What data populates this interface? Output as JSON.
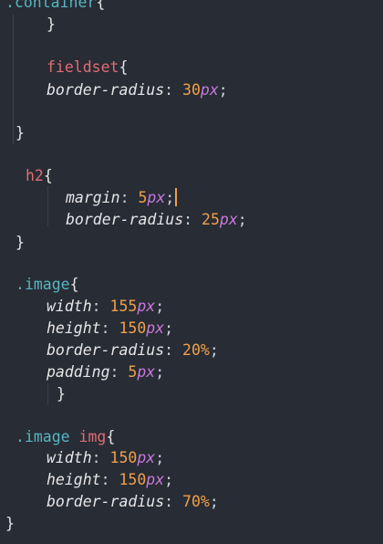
{
  "theme": {
    "background": "#282c34",
    "selector": "#e06c75",
    "class_dot": "#56b6c2",
    "number": "#f0a04b",
    "unit": "#c678dd",
    "cursor": "#f0a04b"
  },
  "code": {
    "container_sel": "container",
    "container_brace": "{",
    "container_close": "}",
    "fieldset_sel": "fieldset",
    "fieldset_brace": "{",
    "fieldset_prop": "border-radius",
    "fieldset_val": "30",
    "fieldset_unit": "px",
    "fieldset_close": "}",
    "h2_sel": "h2",
    "h2_brace": "{",
    "h2_margin_prop": "margin",
    "h2_margin_val": "5",
    "h2_margin_unit": "px",
    "h2_radius_prop": "border-radius",
    "h2_radius_val": "25",
    "h2_radius_unit": "px",
    "h2_close": "}",
    "image_sel": "image",
    "image_brace": "{",
    "image_width_prop": "width",
    "image_width_val": "155",
    "image_width_unit": "px",
    "image_height_prop": "height",
    "image_height_val": "150",
    "image_height_unit": "px",
    "image_radius_prop": "border-radius",
    "image_radius_val": "20%",
    "image_padding_prop": "padding",
    "image_padding_val": "5",
    "image_padding_unit": "px",
    "image_close": "}",
    "imgsel_class": "image",
    "imgsel_tag": "img",
    "imgsel_brace": "{",
    "img_width_prop": "width",
    "img_width_val": "150",
    "img_width_unit": "px",
    "img_height_prop": "height",
    "img_height_val": "150",
    "img_height_unit": "px",
    "img_radius_prop": "border-radius",
    "img_radius_val": "70%",
    "img_close": "}"
  }
}
